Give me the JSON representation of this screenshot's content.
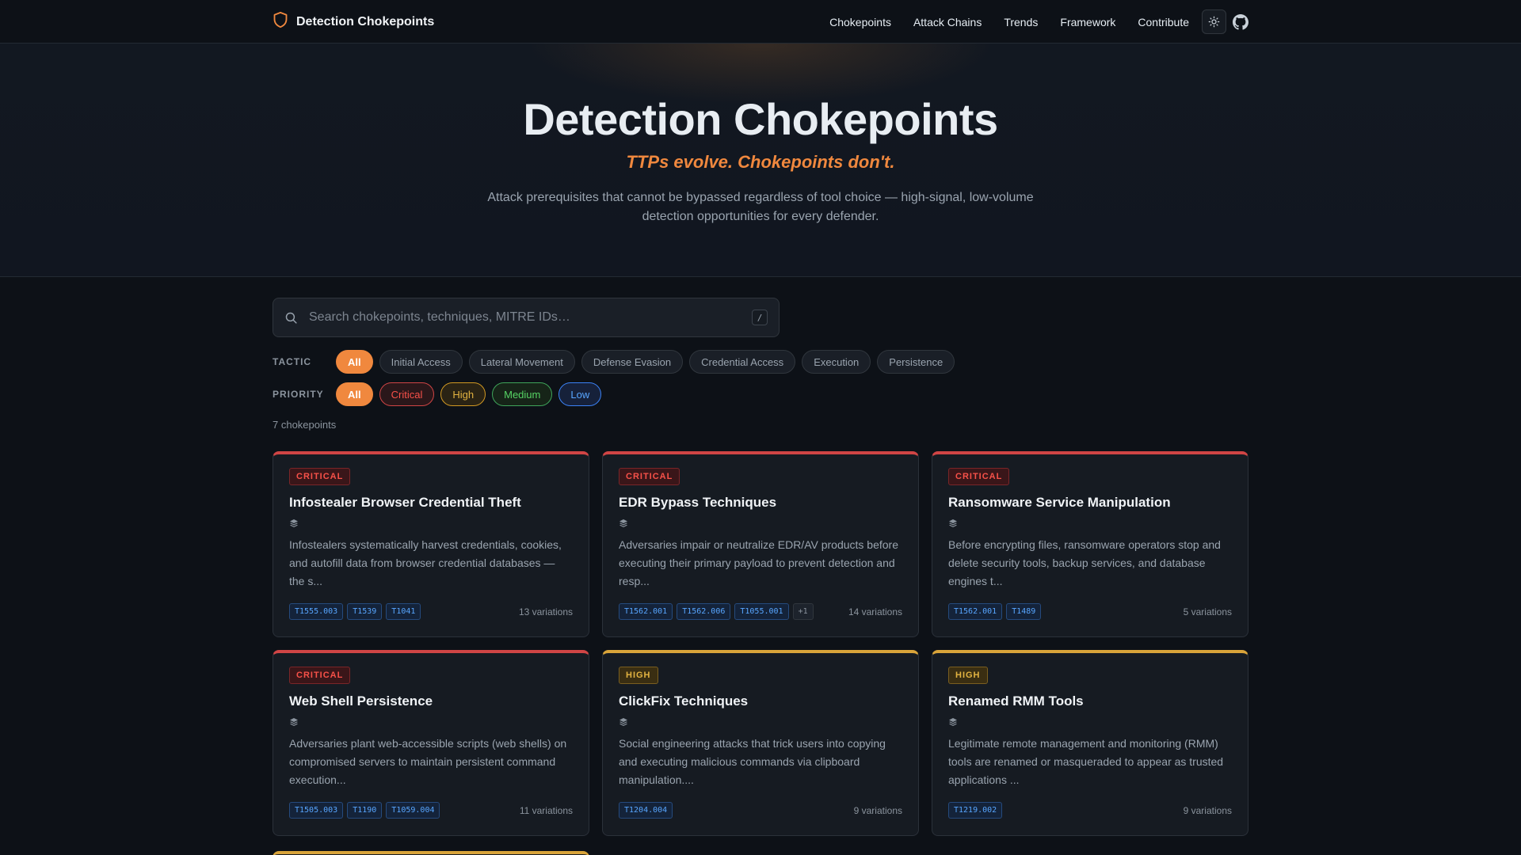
{
  "nav": {
    "brand": "Detection Chokepoints",
    "links": [
      "Chokepoints",
      "Attack Chains",
      "Trends",
      "Framework",
      "Contribute"
    ]
  },
  "hero": {
    "title": "Detection Chokepoints",
    "tagline": "TTPs evolve. Chokepoints don't.",
    "description": "Attack prerequisites that cannot be bypassed regardless of tool choice — high-signal, low-volume detection opportunities for every defender."
  },
  "search": {
    "placeholder": "Search chokepoints, techniques, MITRE IDs…",
    "shortcut": "/"
  },
  "filters": {
    "tactic_label": "TACTIC",
    "tactics": [
      "All",
      "Initial Access",
      "Lateral Movement",
      "Defense Evasion",
      "Credential Access",
      "Execution",
      "Persistence"
    ],
    "priority_label": "PRIORITY",
    "priorities": [
      "All",
      "Critical",
      "High",
      "Medium",
      "Low"
    ]
  },
  "count": "7 chokepoints",
  "colors": {
    "accent": "#f0883e",
    "critical": "#f85149",
    "high": "#e3b341",
    "medium": "#56d364",
    "low": "#58a6ff"
  },
  "cards": [
    {
      "priority": "CRITICAL",
      "title": "Infostealer Browser Credential Theft",
      "description": "Infostealers systematically harvest credentials, cookies, and autofill data from browser credential databases — the s...",
      "tags": [
        "T1555.003",
        "T1539",
        "T1041"
      ],
      "variations": "13 variations"
    },
    {
      "priority": "CRITICAL",
      "title": "EDR Bypass Techniques",
      "description": "Adversaries impair or neutralize EDR/AV products before executing their primary payload to prevent detection and resp...",
      "tags": [
        "T1562.001",
        "T1562.006",
        "T1055.001",
        "+1"
      ],
      "variations": "14 variations"
    },
    {
      "priority": "CRITICAL",
      "title": "Ransomware Service Manipulation",
      "description": "Before encrypting files, ransomware operators stop and delete security tools, backup services, and database engines t...",
      "tags": [
        "T1562.001",
        "T1489"
      ],
      "variations": "5 variations"
    },
    {
      "priority": "CRITICAL",
      "title": "Web Shell Persistence",
      "description": "Adversaries plant web-accessible scripts (web shells) on compromised servers to maintain persistent command execution...",
      "tags": [
        "T1505.003",
        "T1190",
        "T1059.004"
      ],
      "variations": "11 variations"
    },
    {
      "priority": "HIGH",
      "title": "ClickFix Techniques",
      "description": "Social engineering attacks that trick users into copying and executing malicious commands via clipboard manipulation....",
      "tags": [
        "T1204.004"
      ],
      "variations": "9 variations"
    },
    {
      "priority": "HIGH",
      "title": "Renamed RMM Tools",
      "description": "Legitimate remote management and monitoring (RMM) tools are renamed or masqueraded to appear as trusted applications ...",
      "tags": [
        "T1219.002"
      ],
      "variations": "9 variations"
    }
  ]
}
